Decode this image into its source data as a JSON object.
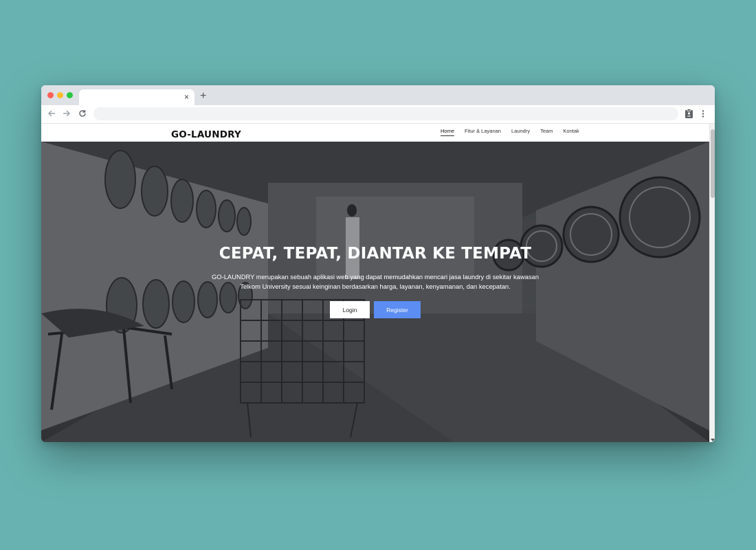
{
  "browser": {
    "tab_title": "",
    "tab_close": "×",
    "new_tab": "+",
    "address": ""
  },
  "site": {
    "brand": "GO-LAUNDRY",
    "nav": [
      {
        "label": "Home",
        "active": true
      },
      {
        "label": "Fitur & Layanan",
        "active": false
      },
      {
        "label": "Laundry",
        "active": false
      },
      {
        "label": "Team",
        "active": false
      },
      {
        "label": "Kontak",
        "active": false
      }
    ]
  },
  "hero": {
    "title": "CEPAT, TEPAT, DIANTAR KE TEMPAT",
    "description": "GO-LAUNDRY merupakan sebuah aplikasi web yang dapat memudahkan mencari jasa laundry di sekitar kawasan Telkom University sesuai keinginan berdasarkan harga, layanan, kenyamanan, dan kecepatan.",
    "login_label": "Login",
    "register_label": "Register"
  },
  "colors": {
    "page_background": "#68b3b1",
    "register_button": "#5b8df2",
    "login_button": "#ffffff"
  }
}
